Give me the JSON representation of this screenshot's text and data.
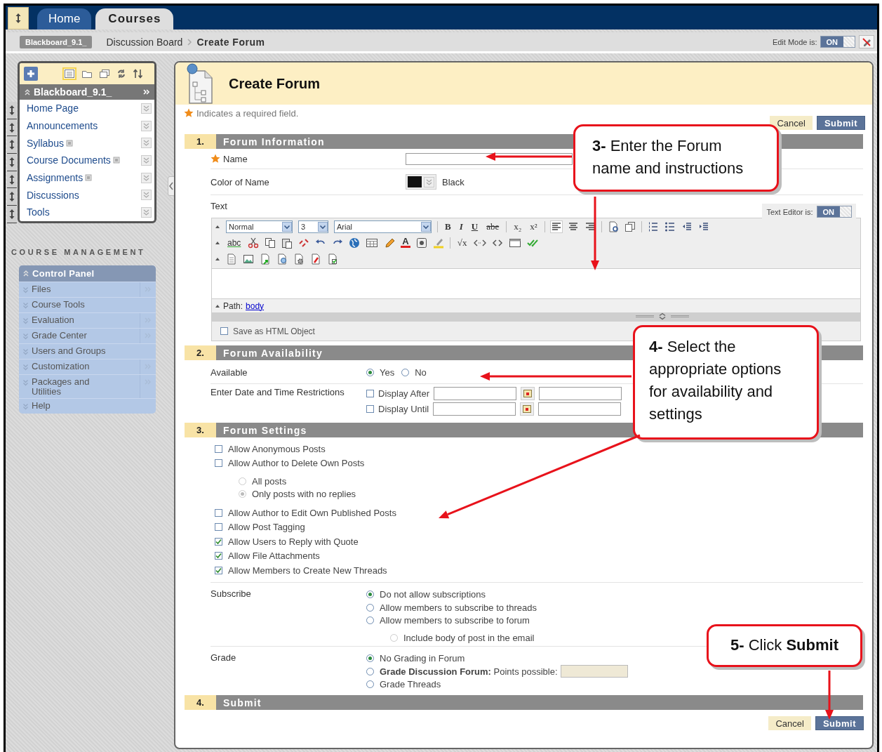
{
  "header": {
    "tabs": [
      {
        "label": "Home",
        "selected": false
      },
      {
        "label": "Courses",
        "selected": true
      }
    ]
  },
  "breadcrumb": {
    "course": "Blackboard_9.1_",
    "path": [
      "Discussion Board",
      "Create Forum"
    ],
    "edit_mode": {
      "label": "Edit Mode is:",
      "value": "ON",
      "on": true
    }
  },
  "course_menu": {
    "title": "Blackboard_9.1_",
    "items": [
      {
        "label": "Home Page",
        "marked": false
      },
      {
        "label": "Announcements",
        "marked": false
      },
      {
        "label": "Syllabus",
        "marked": true
      },
      {
        "label": "Course Documents",
        "marked": true
      },
      {
        "label": "Assignments",
        "marked": true
      },
      {
        "label": "Discussions",
        "marked": false
      },
      {
        "label": "Tools",
        "marked": false
      }
    ]
  },
  "course_management": {
    "heading": "COURSE MANAGEMENT",
    "title": "Control Panel",
    "items": [
      {
        "label": "Files",
        "submenu": true
      },
      {
        "label": "Course Tools",
        "submenu": false
      },
      {
        "label": "Evaluation",
        "submenu": true
      },
      {
        "label": "Grade Center",
        "submenu": true
      },
      {
        "label": "Users and Groups",
        "submenu": false
      },
      {
        "label": "Customization",
        "submenu": true
      },
      {
        "label": "Packages and Utilities",
        "submenu": true
      },
      {
        "label": "Help",
        "submenu": false
      }
    ]
  },
  "page": {
    "title": "Create Forum",
    "required_note": "Indicates a required field.",
    "buttons": [
      {
        "label": "Cancel",
        "kind": "secondary"
      },
      {
        "label": "Submit",
        "kind": "primary"
      }
    ]
  },
  "sections": [
    {
      "number": "1.",
      "title": "Forum Information",
      "fields": [
        {
          "kind": "text",
          "label": "Name",
          "required": true
        },
        {
          "kind": "color",
          "label": "Color of Name",
          "value": "Black"
        },
        {
          "kind": "editor",
          "label": "Text",
          "editor": {
            "toggle_label": "Text Editor is:",
            "toggle_value": "ON",
            "toggle_on": true,
            "toolbar": [
              [
                {
                  "kind": "select",
                  "value": "Normal"
                },
                {
                  "kind": "select",
                  "value": "3"
                },
                {
                  "kind": "select",
                  "value": "Arial"
                },
                {
                  "kind": "sep"
                },
                {
                  "kind": "bold",
                  "label": "B"
                },
                {
                  "kind": "italic",
                  "label": "I"
                },
                {
                  "kind": "underline",
                  "label": "U"
                },
                {
                  "kind": "strike",
                  "label": "abe"
                },
                {
                  "kind": "sep"
                },
                {
                  "kind": "plain",
                  "label": "x₂"
                },
                {
                  "kind": "plain",
                  "label": "x²"
                },
                {
                  "kind": "sep"
                },
                {
                  "kind": "icon"
                },
                {
                  "kind": "icon"
                },
                {
                  "kind": "icon"
                },
                {
                  "kind": "sep"
                },
                {
                  "kind": "icon"
                },
                {
                  "kind": "icon"
                },
                {
                  "kind": "sep"
                },
                {
                  "kind": "icon"
                },
                {
                  "kind": "icon"
                },
                {
                  "kind": "icon"
                },
                {
                  "kind": "icon"
                }
              ],
              [
                {
                  "kind": "spell",
                  "label": "abc"
                },
                {
                  "kind": "icon"
                },
                {
                  "kind": "icon"
                },
                {
                  "kind": "icon"
                },
                {
                  "kind": "icon"
                },
                {
                  "kind": "icon"
                },
                {
                  "kind": "icon"
                },
                {
                  "kind": "icon"
                },
                {
                  "kind": "icon"
                },
                {
                  "kind": "icon"
                },
                {
                  "kind": "color",
                  "label": "A"
                },
                {
                  "kind": "icon"
                },
                {
                  "kind": "icon"
                },
                {
                  "kind": "sep"
                },
                {
                  "kind": "plain",
                  "label": "√x"
                },
                {
                  "kind": "icon"
                },
                {
                  "kind": "icon"
                },
                {
                  "kind": "icon"
                },
                {
                  "kind": "icon"
                }
              ],
              [
                {
                  "kind": "icon"
                },
                {
                  "kind": "icon"
                },
                {
                  "kind": "icon"
                },
                {
                  "kind": "icon"
                },
                {
                  "kind": "icon"
                },
                {
                  "kind": "icon"
                },
                {
                  "kind": "icon"
                }
              ]
            ],
            "path_label": "Path:",
            "path_link": "body",
            "html_option": {
              "label": "Save as HTML Object",
              "checked": false
            }
          }
        }
      ]
    },
    {
      "number": "2.",
      "title": "Forum Availability",
      "fields": [
        {
          "kind": "radios_inline",
          "label": "Available",
          "options": [
            {
              "label": "Yes",
              "selected": true
            },
            {
              "label": "No",
              "selected": false
            }
          ]
        },
        {
          "kind": "dates",
          "label": "Enter Date and Time Restrictions",
          "options": [
            {
              "label": "Display After",
              "checked": false
            },
            {
              "label": "Display Until",
              "checked": false
            }
          ]
        }
      ]
    },
    {
      "number": "3.",
      "title": "Forum Settings",
      "fields": [
        {
          "kind": "checks",
          "options": [
            {
              "label": "Allow Anonymous Posts",
              "checked": false
            },
            {
              "label": "Allow Author to Delete Own Posts",
              "checked": false,
              "suboptions": [
                {
                  "label": "All posts",
                  "selected": false,
                  "disabled": true
                },
                {
                  "label": "Only posts with no replies",
                  "selected": true,
                  "disabled": true
                }
              ]
            },
            {
              "label": "Allow Author to Edit Own Published Posts",
              "checked": false
            },
            {
              "label": "Allow Post Tagging",
              "checked": false
            },
            {
              "label": "Allow Users to Reply with Quote",
              "checked": true
            },
            {
              "label": "Allow File Attachments",
              "checked": true
            },
            {
              "label": "Allow Members to Create New Threads",
              "checked": true
            }
          ]
        },
        {
          "kind": "radios",
          "label": "Subscribe",
          "options": [
            {
              "label": "Do not allow subscriptions",
              "selected": true,
              "has_input": false
            },
            {
              "label": "Allow members to subscribe to threads",
              "selected": false,
              "has_input": false
            },
            {
              "label": "Allow members to subscribe to forum",
              "selected": false,
              "has_input": false,
              "suboptions": [
                {
                  "label": "Include body of post in the email",
                  "selected": false,
                  "disabled": true
                }
              ]
            }
          ]
        },
        {
          "kind": "radios",
          "label": "Grade",
          "options": [
            {
              "label": "No Grading in Forum",
              "selected": true,
              "has_input": false
            },
            {
              "label": "**Grade Discussion Forum:** Points possible:",
              "selected": false,
              "has_input": true
            },
            {
              "label": "Grade Threads",
              "selected": false,
              "has_input": false
            }
          ]
        }
      ]
    },
    {
      "number": "4.",
      "title": "Submit"
    }
  ],
  "bottom_buttons": [
    {
      "label": "Cancel",
      "kind": "secondary"
    },
    {
      "label": "Submit",
      "kind": "primary"
    }
  ],
  "callouts": [
    {
      "text": "**3-** Enter the Forum name and instructions"
    },
    {
      "text": "**4-** Select the appropriate options for availability and settings"
    },
    {
      "text": "**5-** Click **Submit**"
    }
  ]
}
